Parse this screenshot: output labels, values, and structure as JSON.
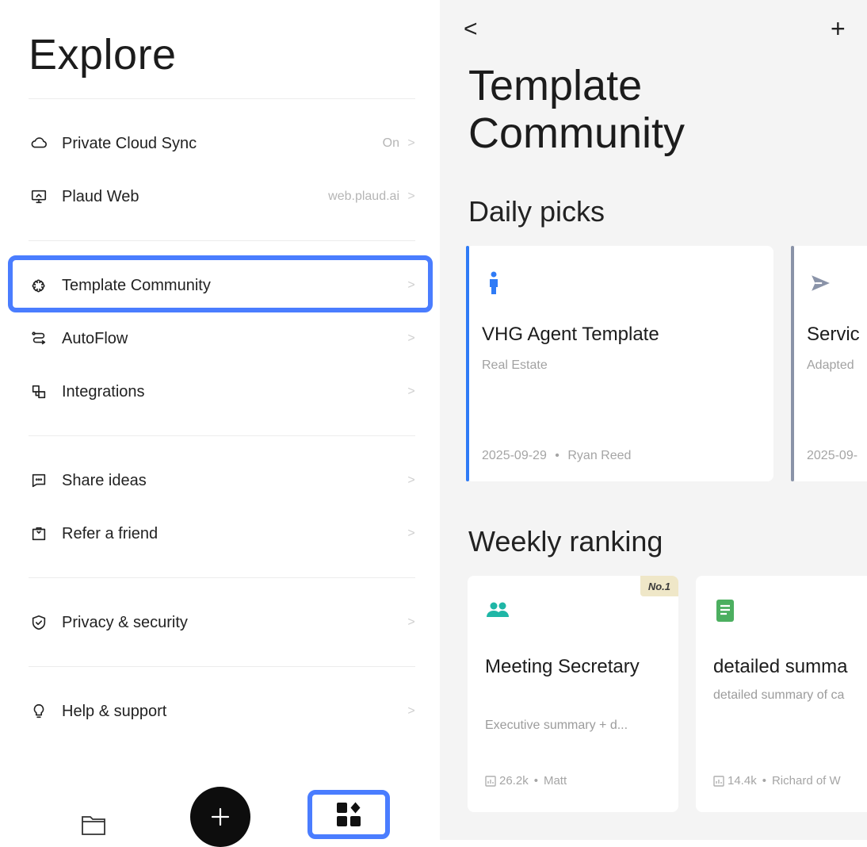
{
  "explore": {
    "title": "Explore",
    "groups": [
      [
        {
          "label": "Private Cloud Sync",
          "value": "On",
          "icon": "cloud-icon"
        },
        {
          "label": "Plaud Web",
          "value": "web.plaud.ai",
          "icon": "monitor-icon"
        }
      ],
      [
        {
          "label": "Template Community",
          "value": "",
          "icon": "puzzle-icon"
        },
        {
          "label": "AutoFlow",
          "value": "",
          "icon": "autoflow-icon"
        },
        {
          "label": "Integrations",
          "value": "",
          "icon": "integrations-icon"
        }
      ],
      [
        {
          "label": "Share ideas",
          "value": "",
          "icon": "chat-icon"
        },
        {
          "label": "Refer a friend",
          "value": "",
          "icon": "gift-icon"
        }
      ],
      [
        {
          "label": "Privacy & security",
          "value": "",
          "icon": "shield-icon"
        }
      ],
      [
        {
          "label": "Help & support",
          "value": "",
          "icon": "lightbulb-icon"
        }
      ]
    ],
    "chevron": ">"
  },
  "bottom_nav": {
    "items": [
      "folder-icon",
      "add-icon",
      "explore-grid-icon"
    ]
  },
  "template_community": {
    "back": "<",
    "add": "+",
    "title": "Template Community",
    "daily_picks": {
      "heading": "Daily picks",
      "cards": [
        {
          "title": "VHG Agent Template",
          "subtitle": "Real Estate",
          "date": "2025-09-29",
          "author": "Ryan Reed",
          "accent": "#2f7bf6",
          "icon": "person-icon"
        },
        {
          "title": "Servic",
          "subtitle": "Adapted",
          "date": "2025-09-",
          "author": "",
          "accent": "#8a93a8",
          "icon": "send-icon"
        }
      ]
    },
    "weekly_ranking": {
      "heading": "Weekly ranking",
      "cards": [
        {
          "badge": "No.1",
          "title": "Meeting Secretary",
          "subtitle": "Executive summary + d...",
          "uses": "26.2k",
          "author": "Matt",
          "icon": "people-icon",
          "icon_color": "#1fb6a6"
        },
        {
          "badge": "",
          "title": "detailed summa",
          "subtitle": "detailed summary of ca",
          "uses": "14.4k",
          "author": "Richard of W",
          "icon": "document-icon",
          "icon_color": "#4caf60"
        }
      ]
    },
    "separator": "•"
  },
  "colors": {
    "highlight": "#4a7dff",
    "right_bg": "#f4f4f4"
  }
}
